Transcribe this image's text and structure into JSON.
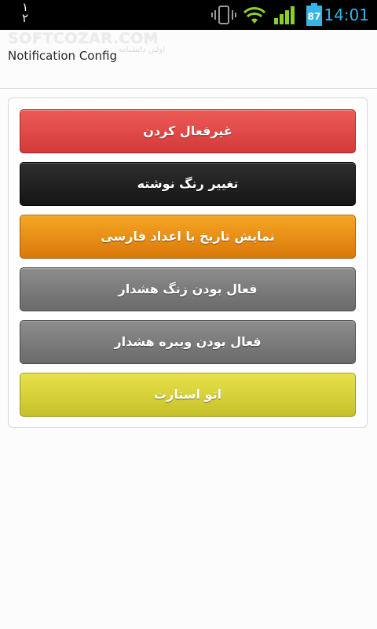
{
  "status_bar": {
    "left_glyph_top": "١",
    "left_glyph_bottom": "٢",
    "battery_level": "87",
    "time": "14:01"
  },
  "title_bar": {
    "watermark": "SOFTCOZAR.COM",
    "watermark_sub": "اولین دانشنامه",
    "title": "Notification Config"
  },
  "buttons": [
    {
      "label": "غیرفعال کردن",
      "color": "#e04a48"
    },
    {
      "label": "تغییر رنگ نوشته",
      "color": "#222222"
    },
    {
      "label": "نمایش تاریخ با اعداد فارسی",
      "color": "#ec8f15"
    },
    {
      "label": "فعال بودن زنگ هشدار",
      "color": "#7b7b7b"
    },
    {
      "label": "فعال بودن ویبره هشدار",
      "color": "#7b7b7b"
    },
    {
      "label": "اتو استارت",
      "color": "#d8d23a"
    }
  ],
  "icons": [
    "vibrate-icon",
    "wifi-icon",
    "signal-icon",
    "battery-icon"
  ],
  "accent_color": "#33b5e5"
}
